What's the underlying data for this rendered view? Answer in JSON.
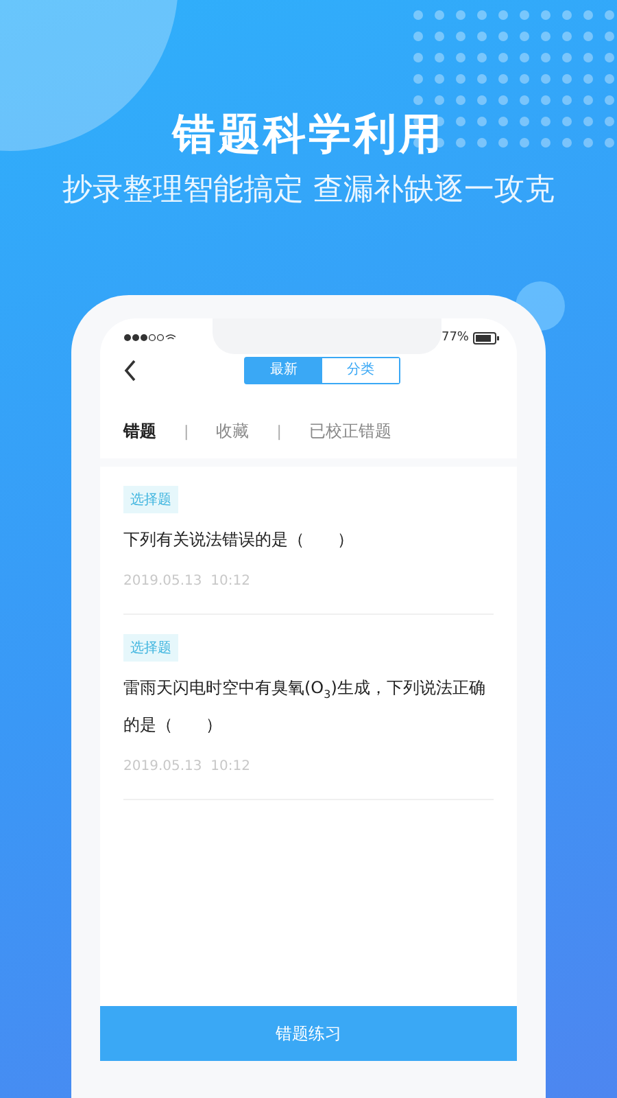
{
  "headline": "错题科学利用",
  "subtitle": "抄录整理智能搞定 查漏补缺逐一攻克",
  "phone": {
    "status_bar": {
      "battery_text": "77%"
    },
    "segments": [
      {
        "label": "最新",
        "selected": true
      },
      {
        "label": "分类",
        "selected": false
      }
    ],
    "tab_bar": [
      {
        "kind": "tab",
        "label": "错题",
        "selected": true
      },
      {
        "kind": "separator",
        "text": "|"
      },
      {
        "kind": "tab",
        "label": "收藏",
        "selected": false
      },
      {
        "kind": "separator",
        "text": "|"
      },
      {
        "kind": "tab",
        "label": "已校正错题",
        "selected": false
      }
    ],
    "questions": [
      {
        "tag": "选择题",
        "text": "下列有关说法错误的是（　　）",
        "time": "2019.05.13  10:12"
      },
      {
        "tag": "选择题",
        "text": "雷雨天闪电时空中有臭氧(O$_{3}$)生成，下列说法正确的是（　　）",
        "time": "2019.05.13  10:12"
      }
    ],
    "button": "错题练习"
  }
}
